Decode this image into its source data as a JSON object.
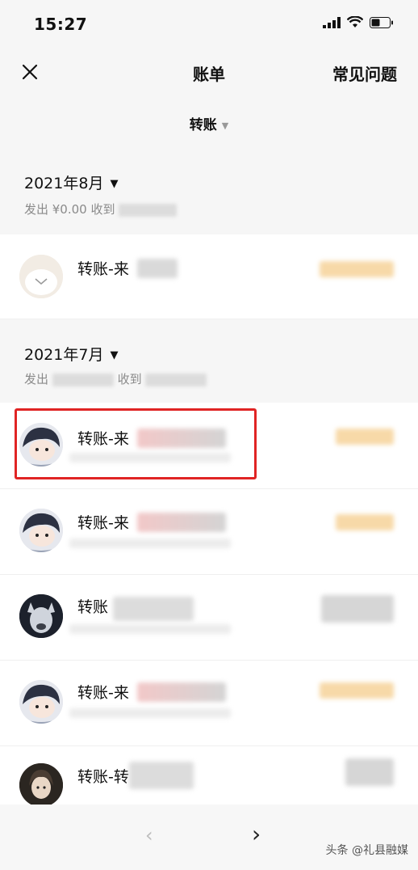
{
  "status_bar": {
    "time": "15:27"
  },
  "nav": {
    "title": "账单",
    "faq_label": "常见问题"
  },
  "filter": {
    "label": "转账"
  },
  "months": [
    {
      "label": "2021年8月",
      "summary_out": "发出 ¥0.00",
      "summary_in": "收到"
    },
    {
      "label": "2021年7月",
      "summary_out": "发出",
      "summary_in": "收到"
    }
  ],
  "transactions": [
    {
      "title": "转账-来"
    },
    {
      "title": "转账-来"
    },
    {
      "title": "转账-来"
    },
    {
      "title": "转账"
    },
    {
      "title": "转账-来"
    },
    {
      "title": "转账-转"
    }
  ],
  "pagination": {
    "prev": "‹",
    "next": "›"
  },
  "watermark": "头条 @礼县融媒",
  "colors": {
    "highlight_border": "#e02424",
    "amount_blur": "#f7d9a8"
  },
  "icons": [
    "close-icon",
    "chevron-down-icon",
    "caret-down-icon",
    "signal-icon",
    "wifi-icon",
    "battery-icon"
  ]
}
